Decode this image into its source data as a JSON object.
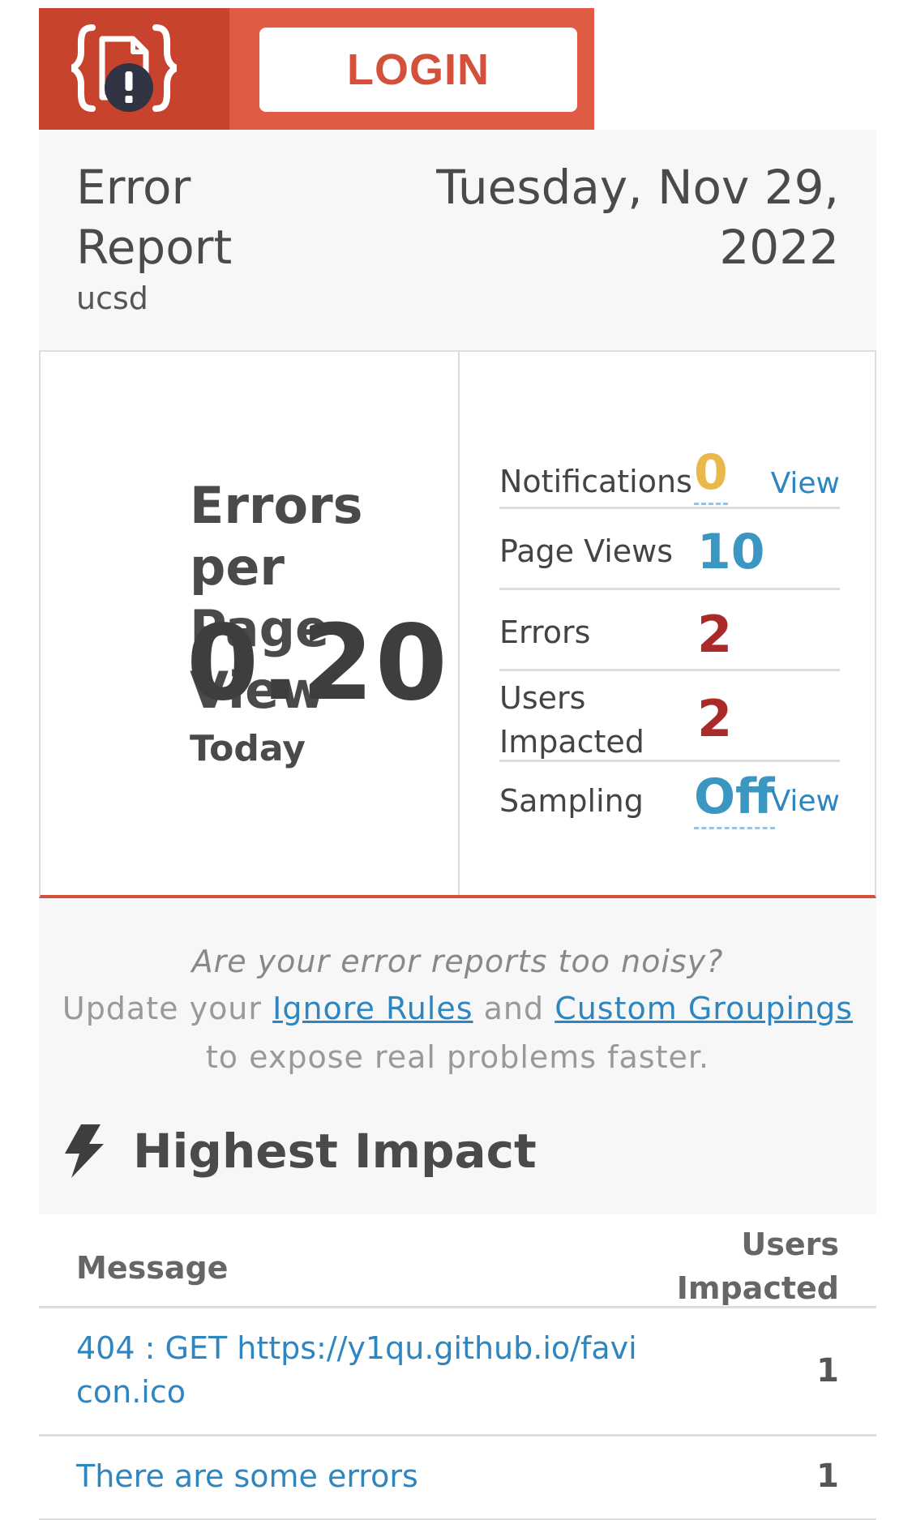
{
  "header": {
    "login_label": "LOGIN"
  },
  "report": {
    "title_line1": "Error",
    "title_line2": "Report",
    "project": "ucsd",
    "date_line1": "Tuesday, Nov 29,",
    "date_line2": "2022"
  },
  "summary": {
    "label_line1": "Errors per",
    "label_line2": "Page View",
    "value": "0.20",
    "period": "Today"
  },
  "stats": {
    "notifications_label": "Notifications",
    "notifications_value": "0",
    "notifications_view": "View",
    "page_views_label": "Page Views",
    "page_views_value": "10",
    "errors_label": "Errors",
    "errors_value": "2",
    "users_label_line1": "Users",
    "users_label_line2": "Impacted",
    "users_value": "2",
    "sampling_label": "Sampling",
    "sampling_value": "Off",
    "sampling_view": "View"
  },
  "noise": {
    "question": "Are your error reports too noisy?",
    "prefix": "Update your ",
    "ignore_rules": "Ignore Rules",
    "middle": " and ",
    "custom_groupings": "Custom Groupings",
    "suffix": " to expose real problems faster."
  },
  "highest_impact": {
    "title": "Highest Impact",
    "col_message": "Message",
    "col_users_line1": "Users",
    "col_users_line2": "Impacted",
    "rows": [
      {
        "message": "404 : GET https://y1qu.github.io/favicon.ico",
        "users": "1"
      },
      {
        "message": "There are some errors",
        "users": "1"
      }
    ]
  },
  "colors": {
    "brand": "#e05a44",
    "brand_dark": "#c8432d",
    "error_red": "#a92a28",
    "link_blue": "#2e86c1",
    "accent_yellow": "#e8b84b"
  }
}
